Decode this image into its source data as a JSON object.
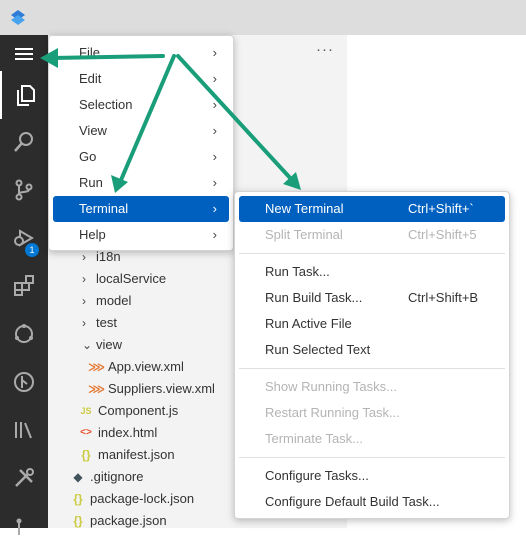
{
  "title_bar": {
    "logo": "vscode-logo-icon"
  },
  "activity_bar": {
    "items": [
      "menu-hamburger-icon",
      "explorer-icon",
      "search-icon",
      "source-control-icon",
      "run-debug-icon",
      "extensions-icon",
      "remote-explorer-icon",
      "git-graph-icon",
      "library-icon",
      "tools-icon",
      "more-icon"
    ],
    "debug_badge": "1"
  },
  "sidebar": {
    "more_label": "···",
    "tree": [
      {
        "chevron": "›",
        "name": "i18n"
      },
      {
        "chevron": "›",
        "name": "localService"
      },
      {
        "chevron": "›",
        "name": "model"
      },
      {
        "chevron": "›",
        "name": "test"
      },
      {
        "chevron": "⌄",
        "name": "view"
      },
      {
        "icon": "⋙",
        "name": "App.view.xml"
      },
      {
        "icon": "⋙",
        "name": "Suppliers.view.xml"
      },
      {
        "icon": "JS",
        "name": "Component.js"
      },
      {
        "icon": "<>",
        "name": "index.html"
      },
      {
        "icon": "{}",
        "name": "manifest.json"
      },
      {
        "icon": "◆",
        "name": ".gitignore"
      },
      {
        "icon": "{}",
        "name": "package-lock.json"
      },
      {
        "icon": "{}",
        "name": "package.json"
      }
    ]
  },
  "menu": {
    "items": [
      {
        "label": "File",
        "arrow": "›"
      },
      {
        "label": "Edit",
        "arrow": "›"
      },
      {
        "label": "Selection",
        "arrow": "›"
      },
      {
        "label": "View",
        "arrow": "›"
      },
      {
        "label": "Go",
        "arrow": "›"
      },
      {
        "label": "Run",
        "arrow": "›"
      },
      {
        "label": "Terminal",
        "arrow": "›",
        "selected": true
      },
      {
        "label": "Help",
        "arrow": "›"
      }
    ]
  },
  "terminal_menu": {
    "items": [
      {
        "label": "New Terminal",
        "shortcut": "Ctrl+Shift+`"
      },
      {
        "label": "Split Terminal",
        "shortcut": "Ctrl+Shift+5"
      },
      {
        "label": "Run Task..."
      },
      {
        "label": "Run Build Task...",
        "shortcut": "Ctrl+Shift+B"
      },
      {
        "label": "Run Active File"
      },
      {
        "label": "Run Selected Text"
      },
      {
        "label": "Show Running Tasks..."
      },
      {
        "label": "Restart Running Task..."
      },
      {
        "label": "Terminate Task..."
      },
      {
        "label": "Configure Tasks..."
      },
      {
        "label": "Configure Default Build Task..."
      }
    ]
  },
  "colors": {
    "accent": "#0060c0",
    "annotation_arrow": "#1a9e7a",
    "activity_bar": "#2c2c2c",
    "title_bar": "#dddddd"
  }
}
